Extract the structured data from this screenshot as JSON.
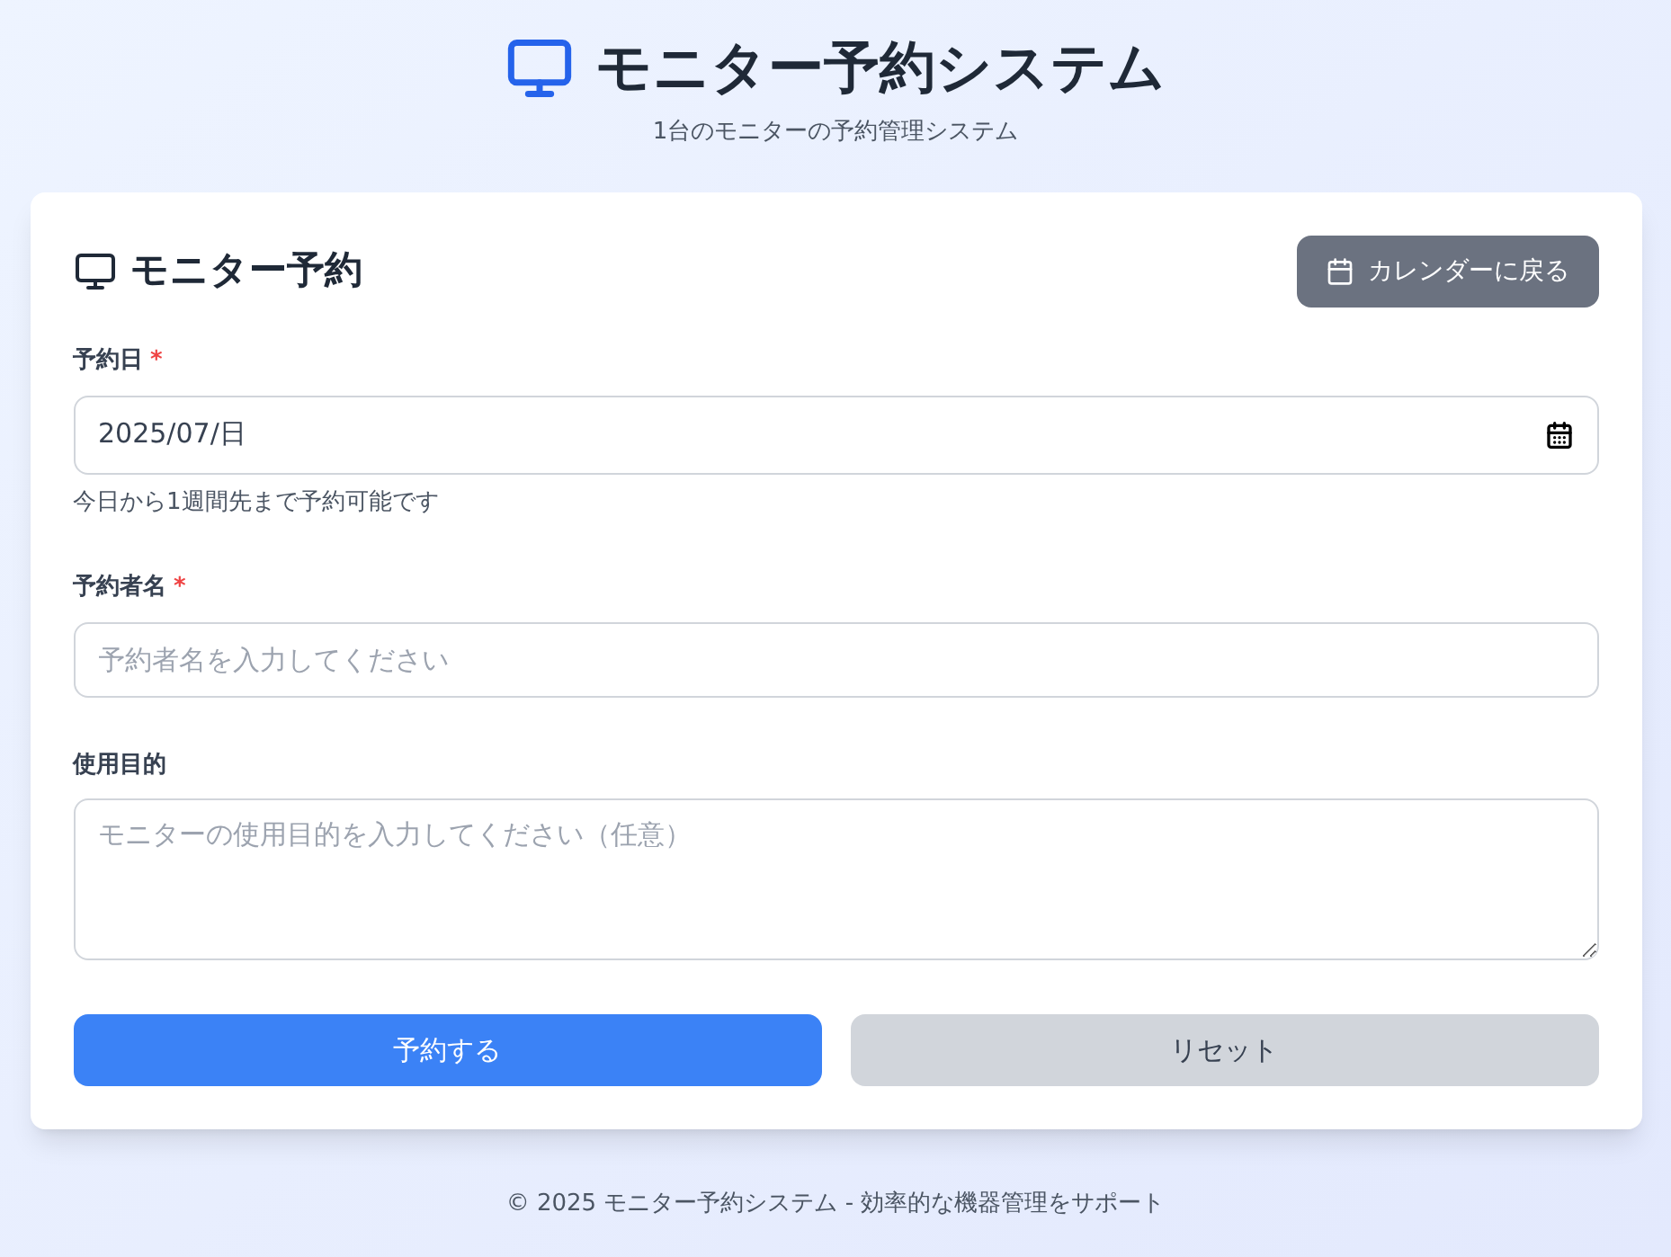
{
  "header": {
    "title": "モニター予約システム",
    "subtitle": "1台のモニターの予約管理システム"
  },
  "card": {
    "title": "モニター予約",
    "back_button": "カレンダーに戻る",
    "fields": [
      {
        "kind": "date",
        "label": "予約日",
        "required_mark": "*",
        "value": "2025/07/日",
        "hint": "今日から1週間先まで予約可能です"
      },
      {
        "kind": "text",
        "label": "予約者名",
        "required_mark": "*",
        "placeholder": "予約者名を入力してください"
      },
      {
        "kind": "textarea",
        "label": "使用目的",
        "placeholder": "モニターの使用目的を入力してください（任意）"
      }
    ],
    "buttons": [
      {
        "kind": "primary",
        "label": "予約する"
      },
      {
        "kind": "secondary",
        "label": "リセット"
      }
    ]
  },
  "footer": "© 2025 モニター予約システム - 効率的な機器管理をサポート"
}
